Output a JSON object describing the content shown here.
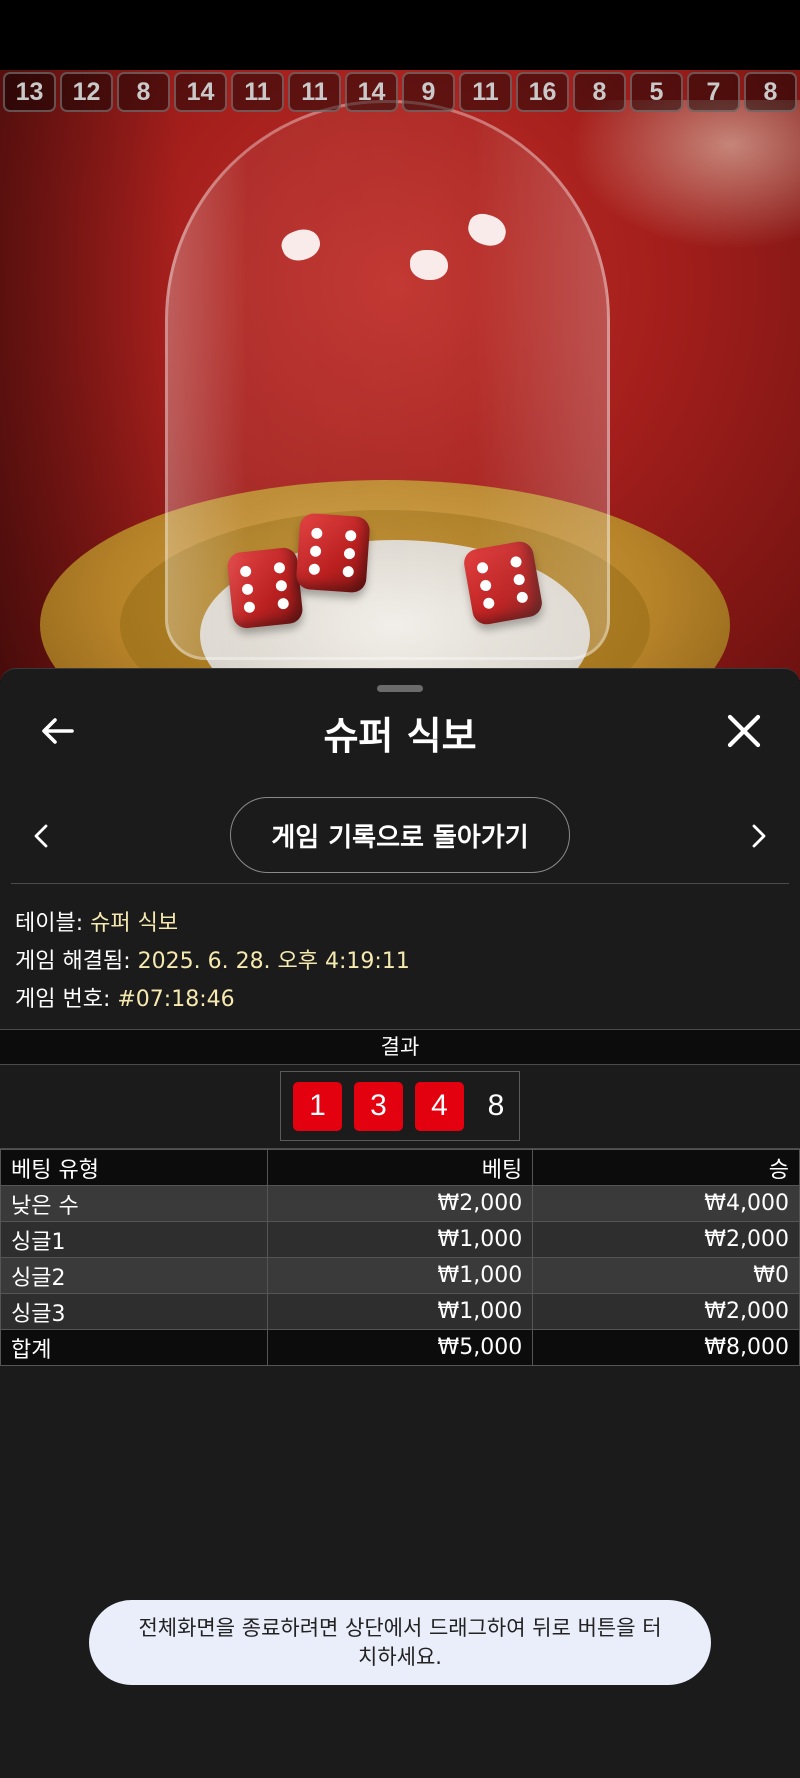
{
  "history": [
    "13",
    "12",
    "8",
    "14",
    "11",
    "11",
    "14",
    "9",
    "11",
    "16",
    "8",
    "5",
    "7",
    "8"
  ],
  "sheet": {
    "title": "슈퍼 식보",
    "back_to_history": "게임 기록으로 돌아가기"
  },
  "info": {
    "table_label": "테이블:",
    "table_value": "슈퍼 식보",
    "resolved_label": "게임 해결됨:",
    "resolved_value": "2025. 6. 28. 오후 4:19:11",
    "game_no_label": "게임 번호:",
    "game_no_value": "#07:18:46"
  },
  "result": {
    "header": "결과",
    "dice": [
      "1",
      "3",
      "4"
    ],
    "total": "8",
    "dice_color": "#e3000f"
  },
  "bets": {
    "headers": [
      "베팅 유형",
      "베팅",
      "승"
    ],
    "rows": [
      [
        "낮은 수",
        "₩2,000",
        "₩4,000"
      ],
      [
        "싱글1",
        "₩1,000",
        "₩2,000"
      ],
      [
        "싱글2",
        "₩1,000",
        "₩0"
      ],
      [
        "싱글3",
        "₩1,000",
        "₩2,000"
      ]
    ],
    "total": [
      "합계",
      "₩5,000",
      "₩8,000"
    ]
  },
  "toast": "전체화면을 종료하려면 상단에서 드래그하여 뒤로 버튼을 터치하세요.",
  "icons": {
    "back": "arrow-left-icon",
    "close": "close-icon",
    "prev": "chevron-left-icon",
    "next": "chevron-right-icon"
  }
}
